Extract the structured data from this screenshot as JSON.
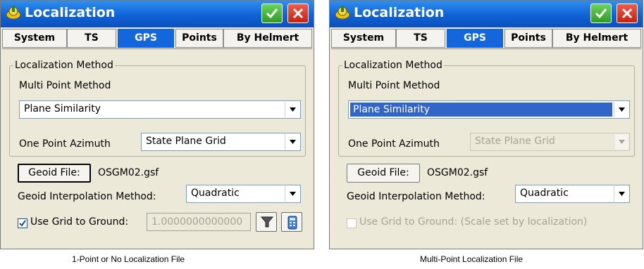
{
  "panels": [
    {
      "title": "Localization",
      "tabs": [
        "System",
        "TS",
        "GPS",
        "Points",
        "By Helmert"
      ],
      "active_tab": "GPS",
      "group_label": "Localization Method",
      "multi_point_label": "Multi Point Method",
      "multi_point_value": "Plane Similarity",
      "one_point_label": "One Point Azimuth",
      "one_point_value": "State Plane Grid",
      "geoid_button": "Geoid File:",
      "geoid_file": "OSGM02.gsf",
      "interp_label": "Geoid Interpolation Method:",
      "interp_value": "Quadratic",
      "grid_ground_label": "Use Grid to Ground:",
      "grid_ground_checked": true,
      "scale_value": "1.0000000000000",
      "caption": "1-Point or No Localization File"
    },
    {
      "title": "Localization",
      "tabs": [
        "System",
        "TS",
        "GPS",
        "Points",
        "By Helmert"
      ],
      "active_tab": "GPS",
      "group_label": "Localization Method",
      "multi_point_label": "Multi Point Method",
      "multi_point_value": "Plane Similarity",
      "one_point_label": "One Point Azimuth",
      "one_point_value": "State Plane Grid",
      "geoid_button": "Geoid File:",
      "geoid_file": "OSGM02.gsf",
      "interp_label": "Geoid Interpolation Method:",
      "interp_value": "Quadratic",
      "grid_ground_label": "Use Grid to Ground:  (Scale set by localization)",
      "grid_ground_checked": false,
      "caption": "Multi-Point Localization File"
    }
  ],
  "icons": {
    "app": "localization-app-icon",
    "ok": "checkmark-icon",
    "close": "close-x-icon",
    "filter": "funnel-icon",
    "calc": "calculator-icon"
  },
  "colors": {
    "titlebar": "#1062d6",
    "active_tab": "#1366dc",
    "ok_button": "#2e9c22",
    "close_button": "#c8200e",
    "selection": "#3165c8"
  }
}
